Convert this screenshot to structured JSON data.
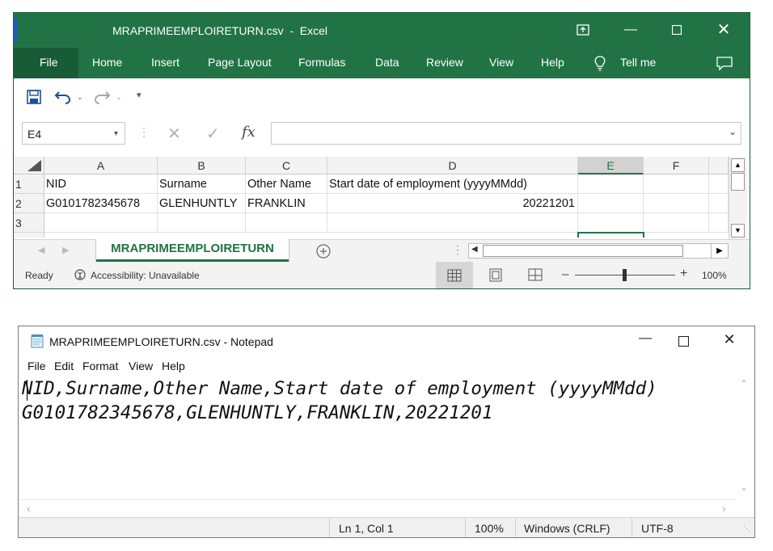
{
  "excel": {
    "title": "MRAPRIMEEMPLOIRETURN.csv  -  Excel",
    "ribbon_tabs": [
      "File",
      "Home",
      "Insert",
      "Page Layout",
      "Formulas",
      "Data",
      "Review",
      "View",
      "Help"
    ],
    "tell_me": "Tell me",
    "name_box": "E4",
    "formula_value": "",
    "fx_label": "fx",
    "columns": [
      "A",
      "B",
      "C",
      "D",
      "E",
      "F"
    ],
    "rows": [
      "1",
      "2",
      "3"
    ],
    "cells": {
      "r1": [
        "NID",
        "Surname",
        "Other Name",
        "Start date of employment (yyyyMMdd)"
      ],
      "r2": [
        "G0101782345678",
        "GLENHUNTLY",
        "FRANKLIN",
        "20221201"
      ]
    },
    "sheet_tab": "MRAPRIMEEMPLOIRETURN",
    "status": {
      "ready": "Ready",
      "accessibility": "Accessibility: Unavailable",
      "zoom": "100%"
    },
    "accent": "#217346"
  },
  "notepad": {
    "title": "MRAPRIMEEMPLOIRETURN.csv - Notepad",
    "menu": [
      "File",
      "Edit",
      "Format",
      "View",
      "Help"
    ],
    "lines": [
      "NID,Surname,Other Name,Start date of employment (yyyyMMdd)",
      "G0101782345678,GLENHUNTLY,FRANKLIN,20221201"
    ],
    "status": {
      "position": "Ln 1, Col 1",
      "zoom": "100%",
      "line_ending": "Windows (CRLF)",
      "encoding": "UTF-8"
    }
  }
}
